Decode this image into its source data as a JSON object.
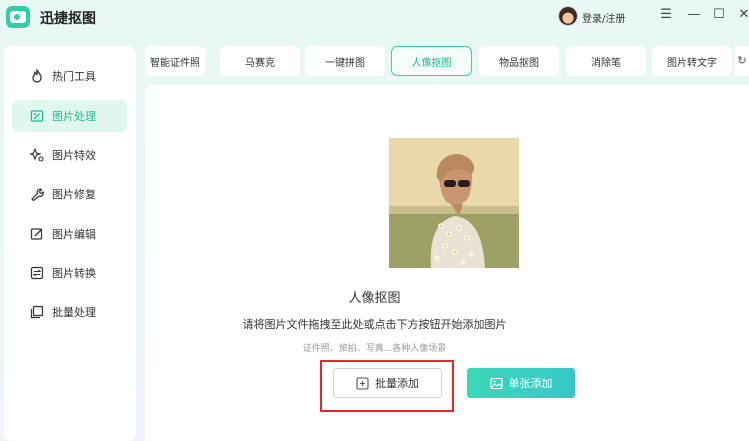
{
  "app": {
    "title": "迅捷抠图",
    "login_label": "登录/注册"
  },
  "window_controls": {
    "menu": "☰",
    "minimize": "—",
    "maximize": "☐",
    "close": "✕"
  },
  "sidebar": {
    "items": [
      {
        "label": "热门工具",
        "icon": "fire-icon"
      },
      {
        "label": "图片处理",
        "icon": "image-edit-icon"
      },
      {
        "label": "图片特效",
        "icon": "sparkle-icon"
      },
      {
        "label": "图片修复",
        "icon": "wrench-icon"
      },
      {
        "label": "图片编辑",
        "icon": "edit-icon"
      },
      {
        "label": "图片转换",
        "icon": "convert-icon"
      },
      {
        "label": "批量处理",
        "icon": "batch-icon"
      }
    ],
    "active_index": 1
  },
  "tabs": {
    "items": [
      "智能证件照",
      "马赛克",
      "一键拼图",
      "人像抠图",
      "物品抠图",
      "消除笔",
      "图片转文字"
    ],
    "active_index": 3,
    "scroll_glyph": "↻"
  },
  "main": {
    "title": "人像抠图",
    "description": "请将图片文件拖拽至此处或点击下方按钮开始添加图片",
    "hint": "证件照、旅拍、写真...各种人像场景",
    "batch_button": "批量添加",
    "single_button": "单张添加"
  },
  "colors": {
    "accent": "#1eb98e",
    "highlight": "#e52727",
    "single_button": "#3cd8b7"
  }
}
